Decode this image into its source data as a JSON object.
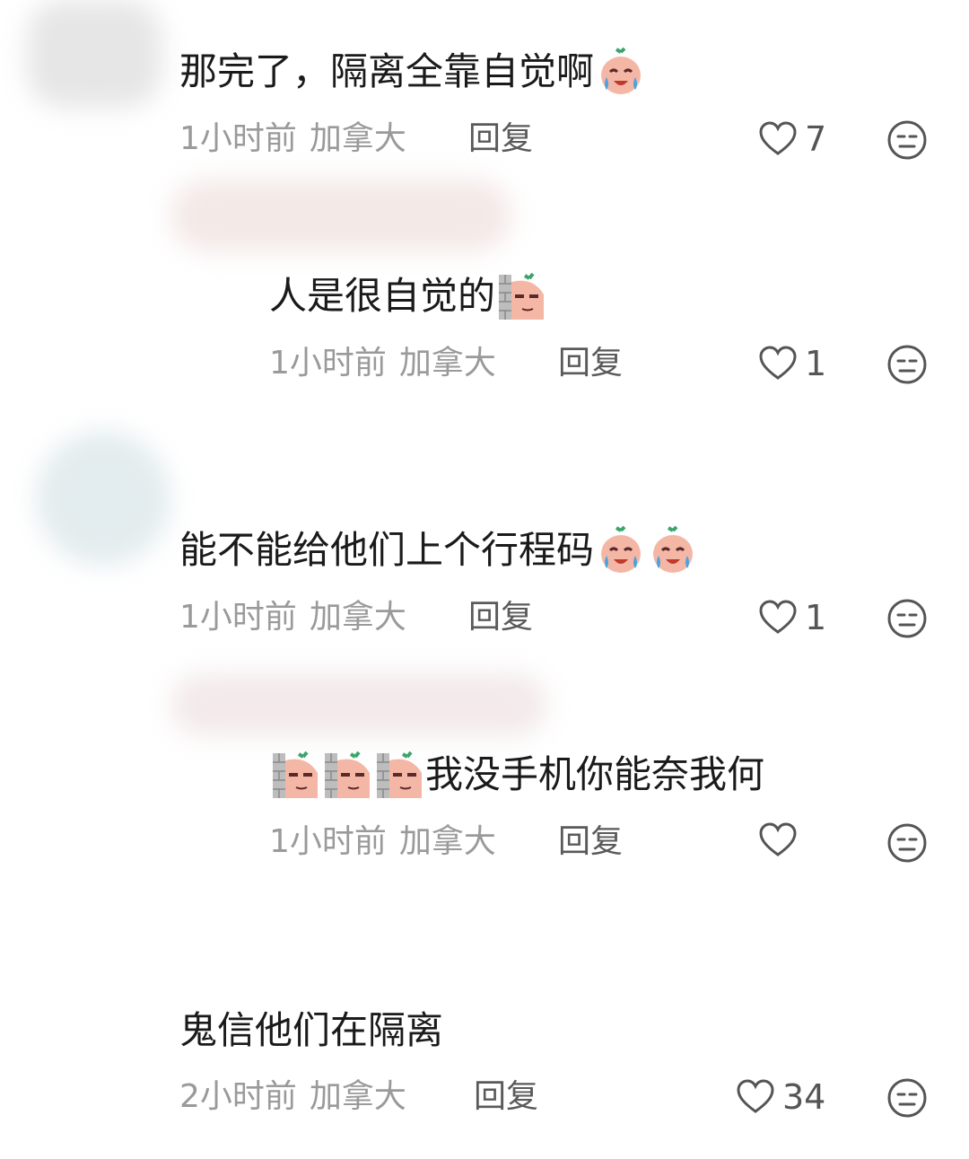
{
  "comments": [
    {
      "text": "那完了，隔离全靠自觉啊",
      "emoji_after": [
        "crying-face-emoji"
      ],
      "time": "1小时前",
      "location": "加拿大",
      "reply": "回复",
      "likes": "7"
    },
    {
      "text": "人是很自觉的",
      "emoji_after": [
        "peeking-wall-emoji"
      ],
      "time": "1小时前",
      "location": "加拿大",
      "reply": "回复",
      "likes": "1"
    },
    {
      "text": "能不能给他们上个行程码",
      "emoji_after": [
        "crying-face-emoji",
        "crying-face-emoji"
      ],
      "time": "1小时前",
      "location": "加拿大",
      "reply": "回复",
      "likes": "1"
    },
    {
      "text": "我没手机你能奈我何",
      "emoji_before": [
        "peeking-wall-emoji",
        "peeking-wall-emoji",
        "peeking-wall-emoji"
      ],
      "time": "1小时前",
      "location": "加拿大",
      "reply": "回复",
      "likes": ""
    },
    {
      "text": "鬼信他们在隔离",
      "time": "2小时前",
      "location": "加拿大",
      "reply": "回复",
      "likes": "34"
    }
  ],
  "icons": {
    "like": "heart-outline-icon",
    "dislike": "neutral-face-icon"
  },
  "colors": {
    "text": "#1a1a1a",
    "meta": "#9a9a9a",
    "icon": "#555555",
    "emoji_face": "#f4b7a6",
    "emoji_leaf": "#3aa56a"
  }
}
